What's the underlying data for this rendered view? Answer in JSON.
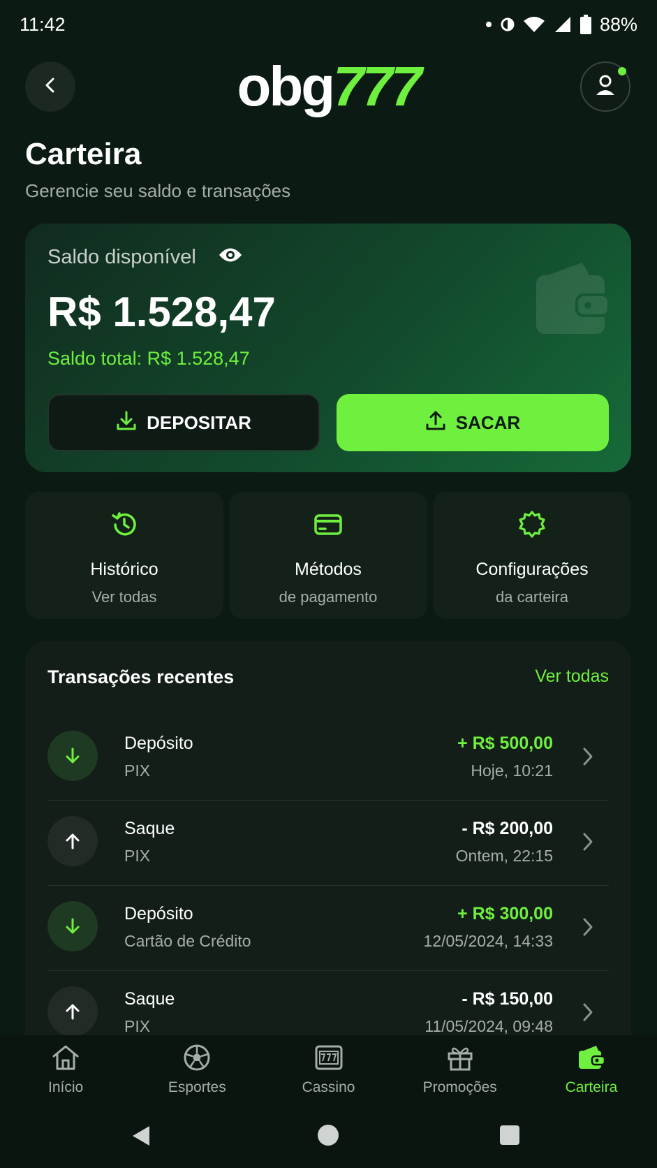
{
  "status_bar": {
    "time": "11:42",
    "battery": "88%"
  },
  "header": {
    "logo_part1": "obg",
    "logo_part2": "777"
  },
  "page": {
    "title": "Carteira",
    "subtitle": "Gerencie seu saldo e transações"
  },
  "balance": {
    "label": "Saldo disponível",
    "value": "R$ 1.528,47",
    "total": "Saldo total: R$ 1.528,47",
    "deposit_label": "DEPOSITAR",
    "withdraw_label": "SACAR"
  },
  "quick_actions": [
    {
      "title": "Histórico",
      "subtitle": "Ver todas",
      "icon": "history-icon"
    },
    {
      "title": "Métodos",
      "subtitle": "de pagamento",
      "icon": "card-icon"
    },
    {
      "title": "Configurações",
      "subtitle": "da carteira",
      "icon": "settings-icon"
    }
  ],
  "transactions": {
    "title": "Transações recentes",
    "see_all": "Ver todas",
    "items": [
      {
        "type": "Depósito",
        "method": "PIX",
        "amount": "+ R$ 500,00",
        "date": "Hoje, 10:21",
        "direction": "in"
      },
      {
        "type": "Saque",
        "method": "PIX",
        "amount": "- R$ 200,00",
        "date": "Ontem, 22:15",
        "direction": "out"
      },
      {
        "type": "Depósito",
        "method": "Cartão de Crédito",
        "amount": "+ R$ 300,00",
        "date": "12/05/2024, 14:33",
        "direction": "in"
      },
      {
        "type": "Saque",
        "method": "PIX",
        "amount": "- R$ 150,00",
        "date": "11/05/2024, 09:48",
        "direction": "out"
      }
    ]
  },
  "bottom_nav": [
    {
      "label": "Início",
      "icon": "home-icon",
      "active": false
    },
    {
      "label": "Esportes",
      "icon": "soccer-ball-icon",
      "active": false
    },
    {
      "label": "Cassino",
      "icon": "slot-machine-icon",
      "active": false
    },
    {
      "label": "Promoções",
      "icon": "gift-icon",
      "active": false
    },
    {
      "label": "Carteira",
      "icon": "wallet-icon",
      "active": true
    }
  ],
  "colors": {
    "accent": "#6ff03f",
    "background": "#0b1a12"
  }
}
